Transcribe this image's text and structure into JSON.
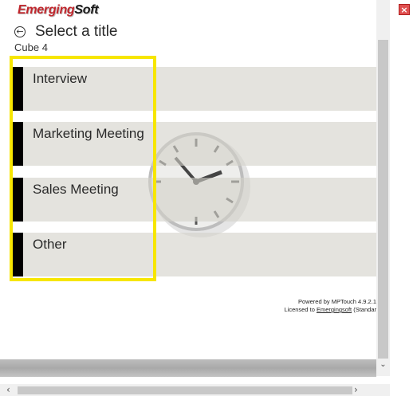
{
  "app": {
    "logo_part1": "Emerging",
    "logo_part2": "Soft"
  },
  "header": {
    "back_glyph": "←",
    "title": "Select a title",
    "subtitle": "Cube 4"
  },
  "items": [
    {
      "label": "Interview"
    },
    {
      "label": "Marketing Meeting"
    },
    {
      "label": "Sales Meeting"
    },
    {
      "label": "Other"
    }
  ],
  "footer": {
    "powered": "Powered by MPTouch 4.9.2.1",
    "licensed_prefix": "Licensed to ",
    "licensed_name": "Emergingsoft",
    "licensed_suffix": " (Standar"
  },
  "colors": {
    "highlight": "#f7e600",
    "accent_bar": "#000000",
    "brand_red": "#c0272d"
  },
  "icons": [
    "back-arrow-icon",
    "clock-watermark-icon",
    "close-icon",
    "scroll-down-icon",
    "scroll-left-icon",
    "scroll-right-icon"
  ]
}
